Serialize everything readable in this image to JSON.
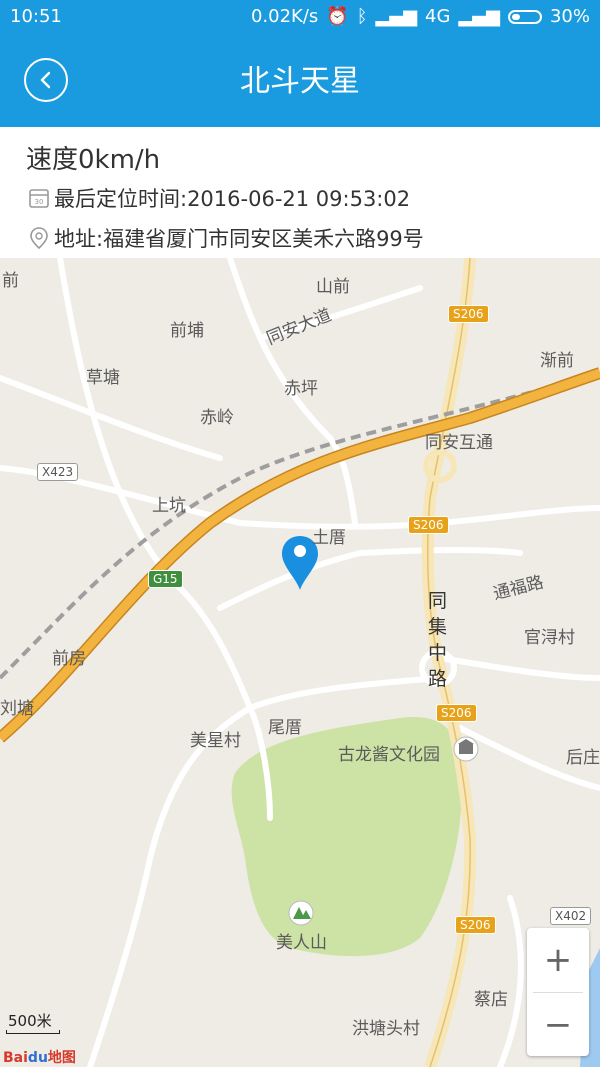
{
  "status_bar": {
    "time": "10:51",
    "net_speed": "0.02K/s",
    "network": "4G",
    "battery": "30%"
  },
  "header": {
    "title": "北斗天星"
  },
  "info": {
    "speed": "速度0km/h",
    "last_fix": "最后定位时间:2016-06-21 09:53:02",
    "address": "地址:福建省厦门市同安区美禾六路99号"
  },
  "map": {
    "labels": {
      "qian_left": "前",
      "shanqian": "山前",
      "qianbu": "前埔",
      "tongan_road": "同安大道",
      "jianqian": "渐前",
      "caotang": "草塘",
      "chiping": "赤坪",
      "chiling": "赤岭",
      "tongan_interchange": "同安互通",
      "shangkeng": "上坑",
      "tucuo": "土厝",
      "tongfu_road": "通福路",
      "tongji_road": "同集中路",
      "guanxun": "官浔村",
      "qianfang": "前房",
      "liutang": "刘塘",
      "weicuo": "尾厝",
      "meixing": "美星村",
      "gulongjiang": "古龙酱文化园",
      "houzhuang": "后庄",
      "meirenshan": "美人山",
      "caidian": "蔡店",
      "hongtang": "洪塘头村"
    },
    "shields": {
      "s206": "S206",
      "x423": "X423",
      "g15": "G15",
      "x402": "X402"
    },
    "scale": "500米",
    "logo_bai": "Bai",
    "logo_du": "du",
    "logo_ditu": "地图"
  },
  "zoom": {
    "in": "+",
    "out": "−"
  },
  "colors": {
    "primary": "#1a9bdf",
    "highway": "#f3b33f",
    "park": "#cde3a6",
    "marker": "#1a8fe0"
  },
  "icons": {
    "back": "chevron-left-icon",
    "calendar": "calendar-icon",
    "location": "location-pin-icon",
    "marker": "map-marker-icon",
    "poi": "museum-icon",
    "mountain": "mountain-icon"
  }
}
